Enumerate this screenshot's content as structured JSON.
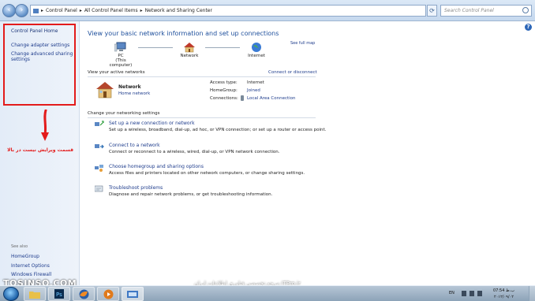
{
  "address": {
    "crumbs": [
      "Control Panel",
      "All Control Panel Items",
      "Network and Sharing Center"
    ],
    "search_placeholder": "Search Control Panel"
  },
  "left_pane": {
    "title": "Control Panel Home",
    "links": [
      "Change adapter settings",
      "Change advanced sharing settings"
    ],
    "see_also_label": "See also",
    "see_also": [
      "HomeGroup",
      "Internet Options",
      "Windows Firewall"
    ],
    "annotation": "قسمت ویرایش نیست در بالا"
  },
  "main": {
    "title": "View your basic network information and set up connections",
    "full_map": "See full map",
    "nodes": {
      "pc_name": "PC",
      "pc_sub": "(This computer)",
      "network": "Network",
      "internet": "Internet"
    },
    "active_label": "View your active networks",
    "connect_link": "Connect or disconnect",
    "active_network": {
      "name": "Network",
      "type": "Home network",
      "access_type_label": "Access type:",
      "access_type": "Internet",
      "homegroup_label": "HomeGroup:",
      "homegroup": "Joined",
      "connections_label": "Connections:",
      "connections": "Local Area Connection"
    },
    "change_label": "Change your networking settings",
    "tasks": [
      {
        "link": "Set up a new connection or network",
        "desc": "Set up a wireless, broadband, dial-up, ad hoc, or VPN connection; or set up a router or access point."
      },
      {
        "link": "Connect to a network",
        "desc": "Connect or reconnect to a wireless, wired, dial-up, or VPN network connection."
      },
      {
        "link": "Choose homegroup and sharing options",
        "desc": "Access files and printers located on other network computers, or change sharing settings."
      },
      {
        "link": "Troubleshoot problems",
        "desc": "Diagnose and repair network problems, or get troubleshooting information."
      }
    ]
  },
  "overlay": {
    "watermark_left": "TOSINSO.COM",
    "watermark_center": "ITPro.ir مرجع تخصصی فناوری اطلاعات ایران"
  },
  "taskbar": {
    "lang": "EN",
    "time": "07:54 ب.ظ",
    "date": "۲۰۱۲/۰۹/۰۲"
  },
  "colors": {
    "link": "#1e3c8c",
    "title": "#1e4f9c",
    "highlight_box": "#e31b1b"
  }
}
